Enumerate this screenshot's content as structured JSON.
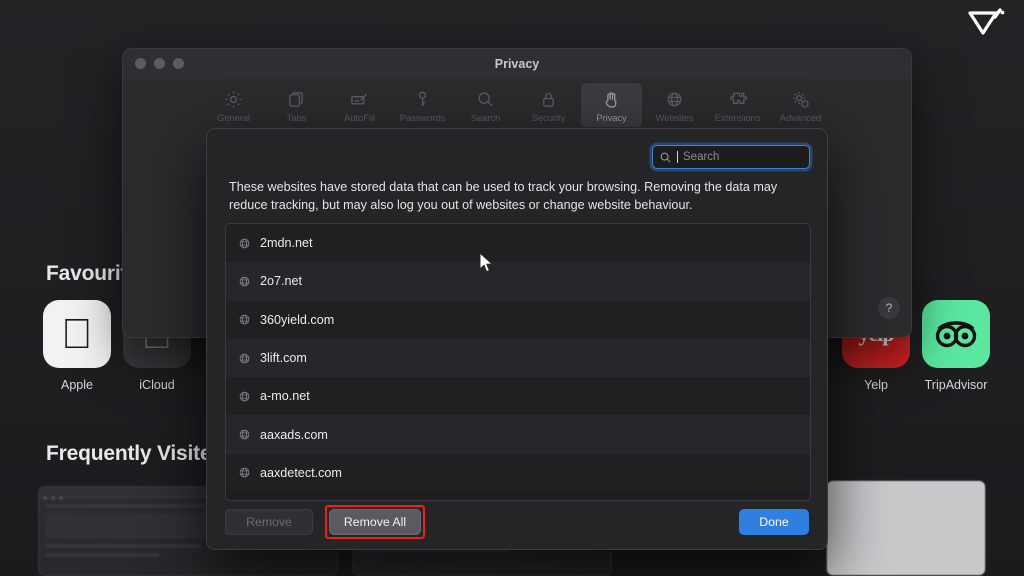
{
  "background": {
    "favourites_heading": "Favourites",
    "frequently_visited_heading": "Frequently Visited",
    "favourites": [
      {
        "label": "Apple",
        "icon": "apple-icon"
      },
      {
        "label": "iCloud",
        "icon": "apple-icon"
      },
      {
        "label": "Yelp",
        "icon": "yelp-icon"
      },
      {
        "label": "TripAdvisor",
        "icon": "tripadvisor-owl-icon"
      }
    ],
    "help_button_label": "?"
  },
  "window": {
    "title": "Privacy",
    "traffic_lights": [
      "close",
      "minimize",
      "zoom"
    ],
    "toolbar": [
      {
        "label": "General",
        "icon": "gear-icon",
        "selected": false
      },
      {
        "label": "Tabs",
        "icon": "tabs-icon",
        "selected": false
      },
      {
        "label": "AutoFill",
        "icon": "autofill-icon",
        "selected": false
      },
      {
        "label": "Passwords",
        "icon": "key-icon",
        "selected": false
      },
      {
        "label": "Search",
        "icon": "search-icon",
        "selected": false
      },
      {
        "label": "Security",
        "icon": "lock-icon",
        "selected": false
      },
      {
        "label": "Privacy",
        "icon": "hand-icon",
        "selected": true
      },
      {
        "label": "Websites",
        "icon": "globe-icon",
        "selected": false
      },
      {
        "label": "Extensions",
        "icon": "puzzle-icon",
        "selected": false
      },
      {
        "label": "Advanced",
        "icon": "advanced-icon",
        "selected": false
      }
    ]
  },
  "sheet": {
    "search": {
      "value": "",
      "placeholder": "Search",
      "icon": "search-icon"
    },
    "description": "These websites have stored data that can be used to track your browsing. Removing the data may reduce tracking, but may also log you out of websites or change website behaviour.",
    "websites": [
      {
        "name": "2mdn.net",
        "icon": "globe-icon"
      },
      {
        "name": "2o7.net",
        "icon": "globe-icon"
      },
      {
        "name": "360yield.com",
        "icon": "globe-icon"
      },
      {
        "name": "3lift.com",
        "icon": "globe-icon"
      },
      {
        "name": "a-mo.net",
        "icon": "globe-icon"
      },
      {
        "name": "aaxads.com",
        "icon": "globe-icon"
      },
      {
        "name": "aaxdetect.com",
        "icon": "globe-icon"
      }
    ],
    "buttons": {
      "remove": "Remove",
      "remove_all": "Remove All",
      "done": "Done"
    }
  },
  "annotation": {
    "color": "#ef1d1d",
    "target": "Remove All"
  },
  "colors": {
    "accent_blue": "#2f7fe0",
    "focus_ring": "#4a7fc1",
    "annotation_red": "#ef1d1d",
    "sheet_bg": "#252528",
    "window_bg": "#2b2b2e"
  }
}
